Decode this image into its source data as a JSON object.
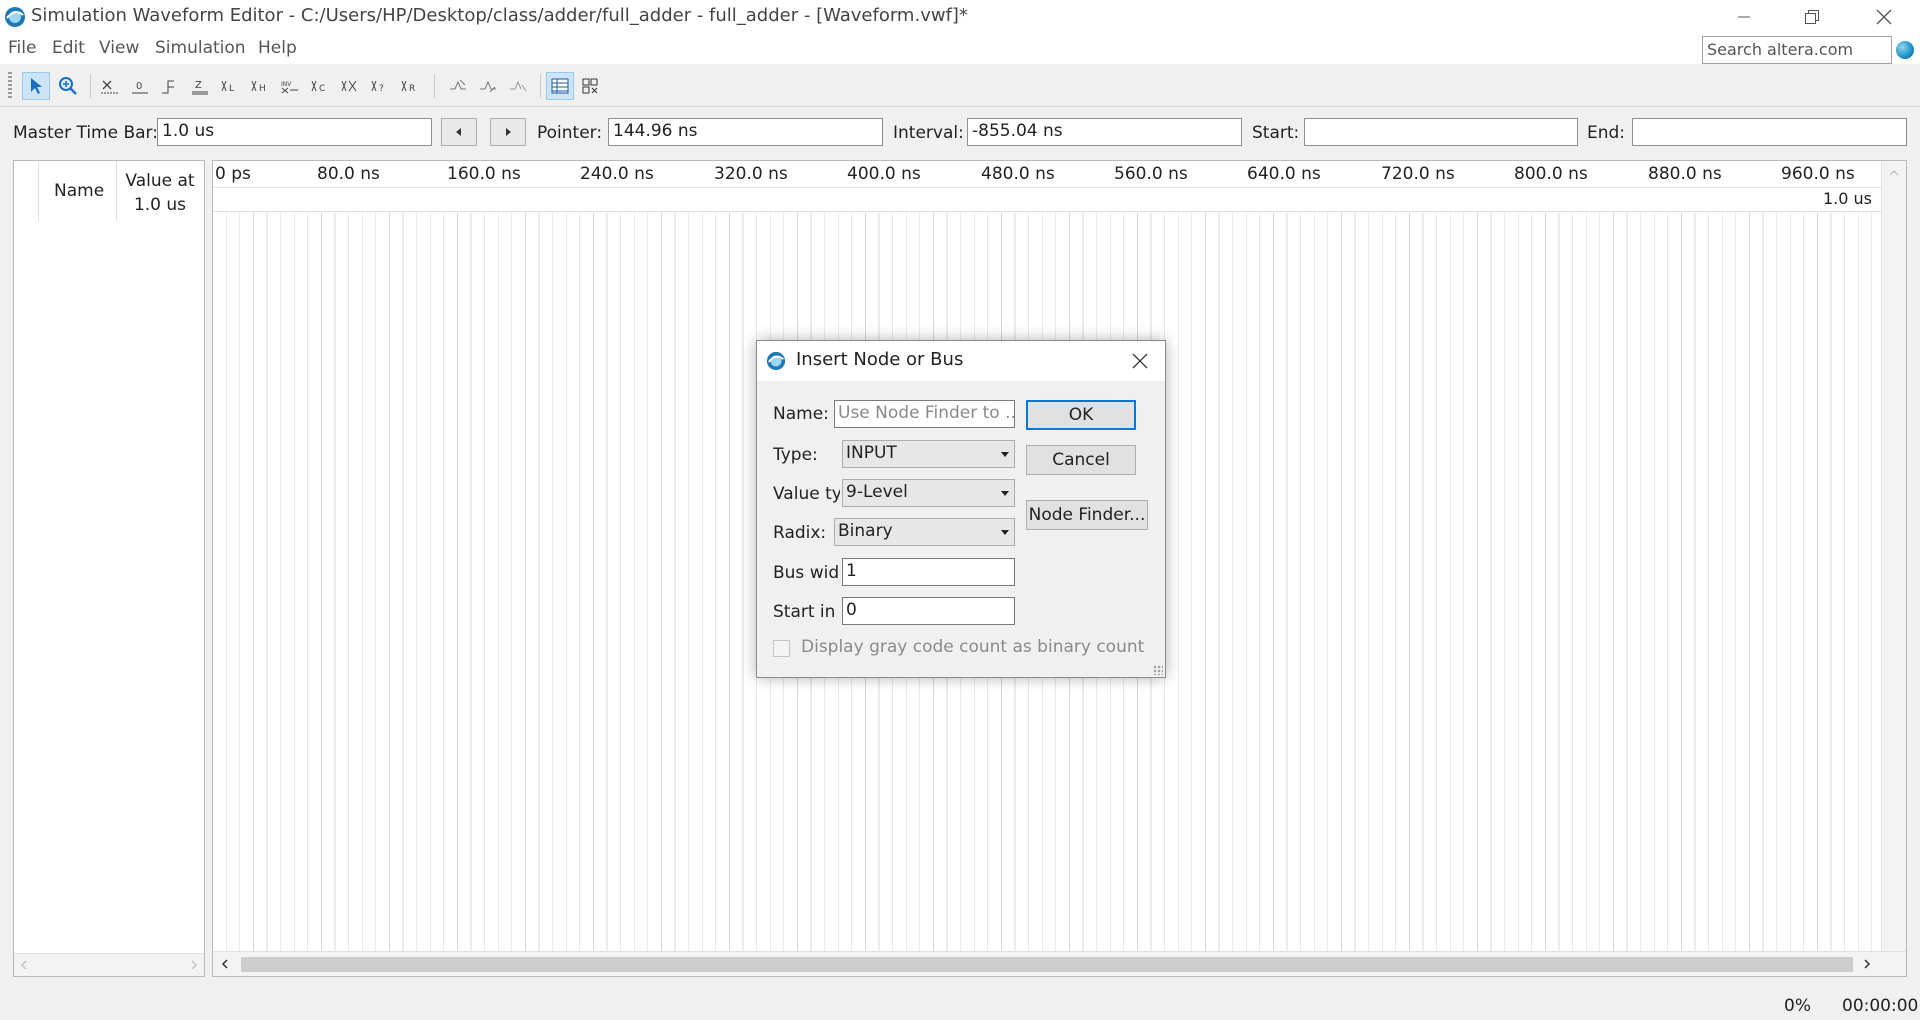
{
  "window": {
    "title": "Simulation Waveform Editor - C:/Users/HP/Desktop/class/adder/full_adder - full_adder - [Waveform.vwf]*"
  },
  "menu": [
    "File",
    "Edit",
    "View",
    "Simulation",
    "Help"
  ],
  "search": {
    "placeholder": "Search altera.com"
  },
  "toolbar": {
    "icons": [
      "selection-tool-icon",
      "zoom-tool-icon",
      "force-unknown-icon",
      "force-low-icon",
      "force-high-icon",
      "force-high-impedance-icon",
      "force-weak-low-icon",
      "force-weak-high-icon",
      "force-weak-unknown-icon",
      "invert-icon",
      "count-value-icon",
      "overwrite-clock-icon",
      "random-values-icon",
      "arbitrary-value-icon",
      "snap-to-grid-icon",
      "sort-icon",
      "insert-node-icon",
      "grid-view-icon",
      "node-list-icon"
    ]
  },
  "timebar": {
    "master_label": "Master Time Bar:",
    "master_value": "1.0 us",
    "pointer_label": "Pointer:",
    "pointer_value": "144.96 ns",
    "interval_label": "Interval:",
    "interval_value": "-855.04 ns",
    "start_label": "Start:",
    "start_value": "",
    "end_label": "End:",
    "end_value": ""
  },
  "node_pane": {
    "name_header": "Name",
    "value_header_line1": "Value at",
    "value_header_line2": "1.0 us"
  },
  "ruler": {
    "ticks": [
      "0 ps",
      "80.0 ns",
      "160.0 ns",
      "240.0 ns",
      "320.0 ns",
      "400.0 ns",
      "480.0 ns",
      "560.0 ns",
      "640.0 ns",
      "720.0 ns",
      "800.0 ns",
      "880.0 ns",
      "960.0 ns"
    ],
    "end_marker": "1.0 us"
  },
  "status": {
    "progress": "0%",
    "elapsed": "00:00:00"
  },
  "dialog": {
    "title": "Insert Node or Bus",
    "name_label": "Name:",
    "name_placeholder": "Use Node Finder to ...",
    "type_label": "Type:",
    "type_value": "INPUT",
    "value_type_label": "Value ty",
    "value_type_value": "9-Level",
    "radix_label": "Radix:",
    "radix_value": "Binary",
    "bus_width_label": "Bus wid",
    "bus_width_value": "1",
    "start_index_label": "Start in",
    "start_index_value": "0",
    "gray_code_label": "Display gray code count as binary count",
    "gray_code_checked": false,
    "ok_label": "OK",
    "cancel_label": "Cancel",
    "node_finder_label": "Node Finder..."
  }
}
